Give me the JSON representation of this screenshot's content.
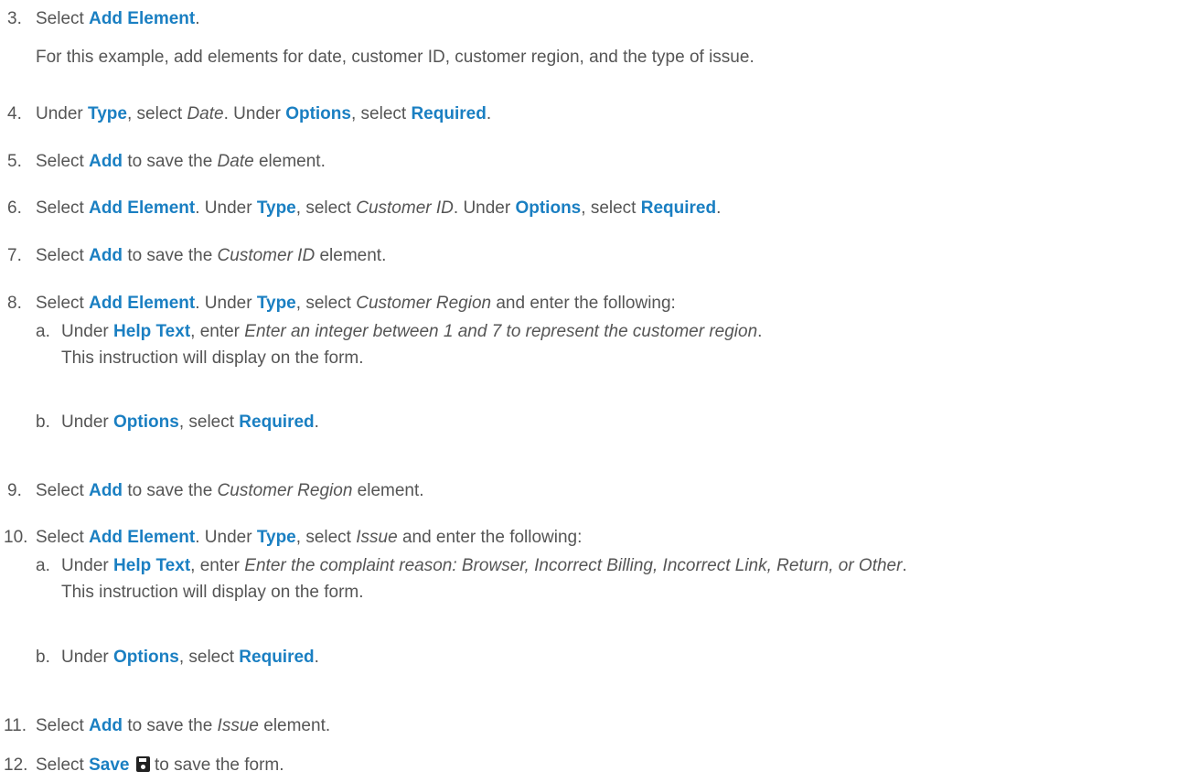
{
  "common": {
    "select": "Select",
    "under": "Under",
    "select_lc": "select",
    "enter": "enter",
    "add_element": "Add Element",
    "add": "Add",
    "type": "Type",
    "options": "Options",
    "required": "Required",
    "help_text": "Help Text",
    "period": ".",
    "comma": ",",
    "to_save_the": "to save the",
    "element": "element.",
    "and_enter_following": "and enter the following:",
    "instruction_display": "This instruction will display on the form.",
    "sub_a": "a.",
    "sub_b": "b."
  },
  "steps": {
    "s3": {
      "num": "3.",
      "note": "For this example, add elements for date, customer ID, customer region, and the type of issue."
    },
    "s4": {
      "num": "4.",
      "type_value": "Date"
    },
    "s5": {
      "num": "5.",
      "element_name": "Date"
    },
    "s6": {
      "num": "6.",
      "type_value": "Customer ID"
    },
    "s7": {
      "num": "7.",
      "element_name": "Customer ID"
    },
    "s8": {
      "num": "8.",
      "type_value": "Customer Region",
      "help_value": "Enter an integer between 1 and 7 to represent the customer region"
    },
    "s9": {
      "num": "9.",
      "element_name": "Customer Region"
    },
    "s10": {
      "num": "10.",
      "type_value": "Issue",
      "help_value": "Enter the complaint reason: Browser, Incorrect Billing, Incorrect Link, Return, or Other"
    },
    "s11": {
      "num": "11.",
      "element_name": "Issue"
    },
    "s12": {
      "num": "12.",
      "save_label": "Save",
      "save_icon": "floppy-disk-icon",
      "suffix": "to save the form."
    }
  }
}
